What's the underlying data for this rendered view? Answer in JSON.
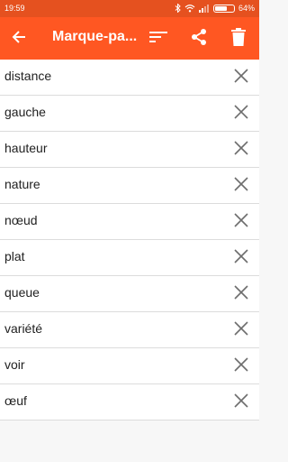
{
  "status_bar": {
    "time": "19:59",
    "battery_percent": "64%",
    "battery_level": 0.64,
    "icons": [
      "bluetooth-icon",
      "wifi-icon",
      "signal-icon",
      "battery-icon"
    ]
  },
  "app_bar": {
    "title": "Marque-pa...",
    "background_color": "#ff5722",
    "status_color": "#e5511f",
    "icons": [
      "back-arrow-icon",
      "sort-icon",
      "share-icon",
      "trash-icon"
    ]
  },
  "bookmarks": {
    "items": [
      {
        "label": "distance"
      },
      {
        "label": "gauche"
      },
      {
        "label": "hauteur"
      },
      {
        "label": "nature"
      },
      {
        "label": "nœud"
      },
      {
        "label": "plat"
      },
      {
        "label": "queue"
      },
      {
        "label": "variété"
      },
      {
        "label": "voir"
      },
      {
        "label": "œuf"
      }
    ],
    "remove_icon": "close-icon"
  }
}
